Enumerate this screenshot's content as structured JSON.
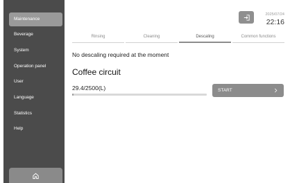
{
  "sidebar": {
    "items": [
      {
        "label": "Maintenance",
        "active": true
      },
      {
        "label": "Beverage"
      },
      {
        "label": "System"
      },
      {
        "label": "Operation panel"
      },
      {
        "label": "User"
      },
      {
        "label": "Language"
      },
      {
        "label": "Statistics"
      },
      {
        "label": "Help"
      }
    ],
    "home_icon": "home-icon"
  },
  "header": {
    "date": "2025/07/24",
    "time": "22:16",
    "exit_icon": "exit-icon"
  },
  "tabs": [
    {
      "label": "Rinsing"
    },
    {
      "label": "Cleaning"
    },
    {
      "label": "Descaling",
      "active": true
    },
    {
      "label": "Common functions"
    }
  ],
  "main": {
    "status": "No descaling required at the moment",
    "section_title": "Coffee circuit",
    "counter": "29.4/2500(L)",
    "progress_fraction": 0.0118,
    "start_label": "START"
  },
  "colors": {
    "sidebar_bg": "#4b4b4b",
    "active_item": "#9a9a9a",
    "button": "#8c8c8c"
  }
}
